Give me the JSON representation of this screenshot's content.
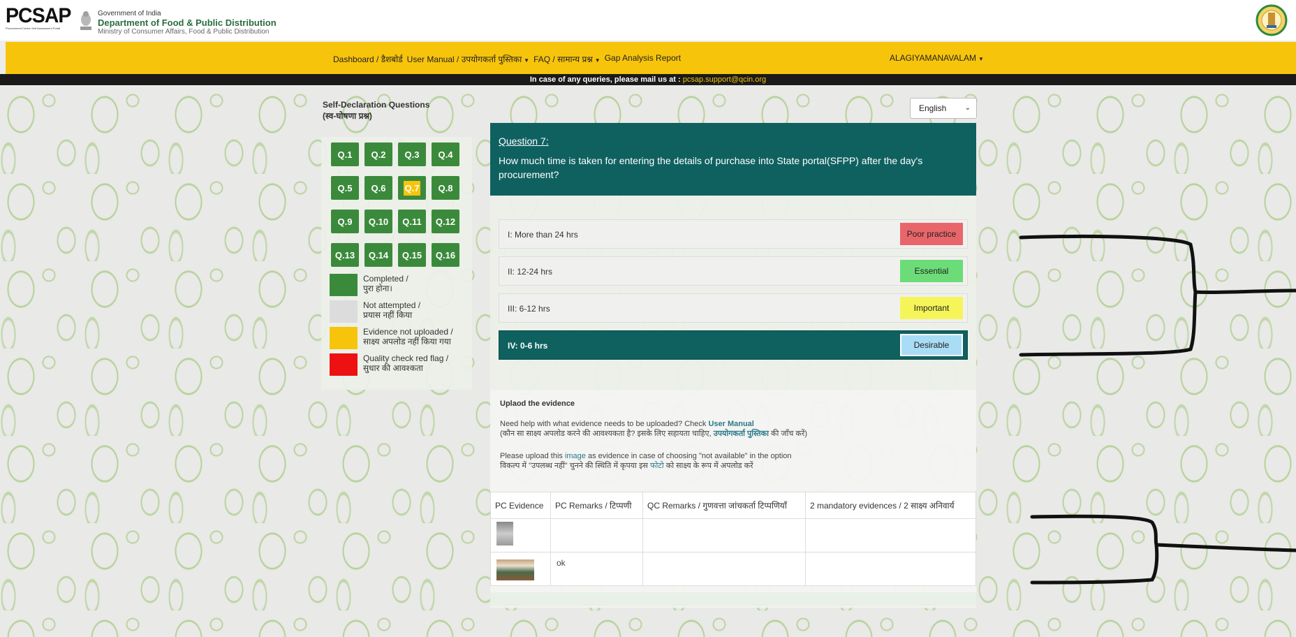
{
  "header": {
    "logo_text": "PCSAP",
    "logo_sub": "Procurement Centre Self Assessment Portal",
    "gov_line1": "Government of India",
    "gov_line2": "Department of Food & Public Distribution",
    "gov_line3": "Ministry of Consumer Affairs, Food & Public Distribution"
  },
  "nav": {
    "items": [
      {
        "label": "Dashboard / डैशबोर्ड",
        "dropdown": false
      },
      {
        "label": "User Manual / उपयोगकर्ता पुस्तिका",
        "dropdown": true
      },
      {
        "label": "FAQ / सामान्य प्रश्न",
        "dropdown": true
      },
      {
        "label": "Gap Analysis Report",
        "dropdown": false
      }
    ],
    "user": "ALAGIYAMANAVALAM"
  },
  "infobar": {
    "text": "In case of any queries, please mail us at :",
    "email": "pcsap.support@qcin.org"
  },
  "sidebar": {
    "title_en": "Self-Declaration Questions",
    "title_hi": "(स्व-घोषणा प्रश्न)",
    "questions": [
      "Q.1",
      "Q.2",
      "Q.3",
      "Q.4",
      "Q.5",
      "Q.6",
      "Q.7",
      "Q.8",
      "Q.9",
      "Q.10",
      "Q.11",
      "Q.12",
      "Q.13",
      "Q.14",
      "Q.15",
      "Q.16"
    ],
    "current": "Q.7",
    "legend": [
      {
        "en": "Completed /",
        "hi": "पुरा होना।",
        "color": "#3b8a3c"
      },
      {
        "en": "Not attempted /",
        "hi": "प्रयास नहीं किया",
        "color": "#dcdcdc"
      },
      {
        "en": "Evidence not uploaded /",
        "hi": "साक्ष्य अपलोड नहीं किया गया",
        "color": "#f7c40c"
      },
      {
        "en": "Quality check red flag /",
        "hi": "सुधार की आवश्कता",
        "color": "#ee1111"
      }
    ]
  },
  "language": {
    "selected": "English"
  },
  "question": {
    "number": "Question 7:",
    "text": "How much time is taken for entering the details of purchase into State portal(SFPP) after the day's procurement?",
    "options": [
      {
        "label": "I: More than 24 hrs",
        "tag": "Poor practice",
        "color": "#e8666a",
        "selected": false
      },
      {
        "label": "II: 12-24 hrs",
        "tag": "Essential",
        "color": "#6cdc78",
        "selected": false
      },
      {
        "label": "III: 6-12 hrs",
        "tag": "Important",
        "color": "#f5f55a",
        "selected": false
      },
      {
        "label": "IV: 0-6 hrs",
        "tag": "Desirable",
        "color": "#a9dcf5",
        "selected": true
      }
    ]
  },
  "upload": {
    "title": "Uplaod the evidence",
    "help_en_prefix": "Need help with what evidence needs to be uploaded? Check ",
    "help_en_link": "User Manual",
    "help_hi_prefix": "(कौन सा साक्ष्य अपलोड करने की आवश्यकता है? इसके लिए सहायता चाहिए, ",
    "help_hi_link": "उपयोगकर्ता पुस्तिका",
    "help_hi_suffix": " की जाँच करें)",
    "image_en_prefix": "Please upload this ",
    "image_en_link": "image",
    "image_en_suffix": " as evidence in case of choosing \"not available\" in the option",
    "image_hi_prefix": "विकल्प में \"उपलब्ध नहीं\" चुनने की स्थिति में कृपया इस ",
    "image_hi_link": "फोटो",
    "image_hi_suffix": " को साक्ष्य के रूप में अपलोड करें"
  },
  "evidence_table": {
    "headers": [
      "PC Evidence",
      "PC Remarks / टिप्पणी",
      "QC Remarks / गुणवत्ता जांचकर्ता टिप्पणियाँ",
      "2 mandatory evidences / 2 साक्ष्य अनिवार्य"
    ],
    "rows": [
      {
        "pc_remarks": "",
        "qc_remarks": "",
        "mandatory": ""
      },
      {
        "pc_remarks": "ok",
        "qc_remarks": "",
        "mandatory": ""
      }
    ]
  }
}
